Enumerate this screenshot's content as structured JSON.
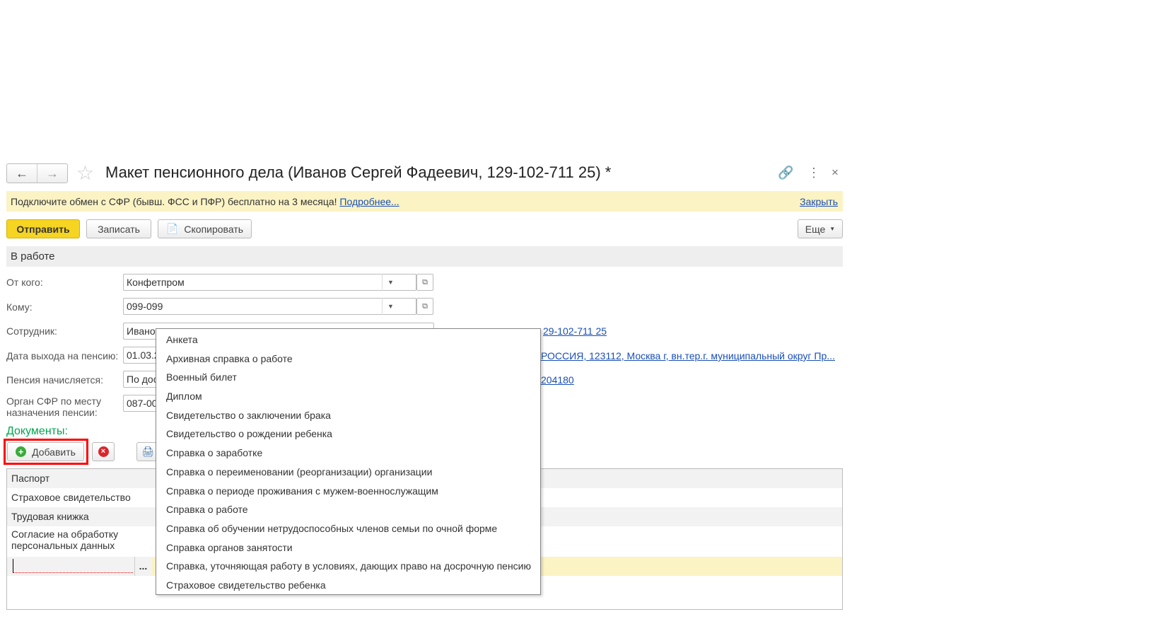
{
  "window": {
    "title": "Макет пенсионного дела (Иванов Сергей Фадеевич, 129-102-711 25) *"
  },
  "banner": {
    "text": "Подключите обмен с СФР (бывш. ФСС и ПФР) бесплатно на 3 месяца!",
    "more_link": "Подробнее...",
    "close_link": "Закрыть"
  },
  "toolbar": {
    "send": "Отправить",
    "save": "Записать",
    "copy": "Скопировать",
    "more": "Еще"
  },
  "status": "В работе",
  "form": {
    "from": {
      "label": "От кого:",
      "value": "Конфетпром"
    },
    "to": {
      "label": "Кому:",
      "value": "099-099"
    },
    "employee": {
      "label": "Сотрудник:",
      "value": "Ивано",
      "link": "29-102-711 25"
    },
    "retire_date": {
      "label": "Дата выхода на пенсию:",
      "value": "01.03.2",
      "link": "РОССИЯ, 123112, Москва г, вн.тер.г. муниципальный округ Пр..."
    },
    "pension": {
      "label": "Пенсия начисляется:",
      "value": "По дос",
      "link": "204180"
    },
    "sfr": {
      "label1": "Орган СФР по месту",
      "label2": "назначения пенсии:",
      "value": "087-00"
    }
  },
  "documents": {
    "label": "Документы:",
    "add": "Добавить",
    "rows": [
      "Паспорт",
      "Страховое свидетельство",
      "Трудовая книжка",
      "Согласие на обработку персональных данных"
    ],
    "edit_ellipsis": "..."
  },
  "dropdown": [
    "Анкета",
    "Архивная справка о работе",
    "Военный билет",
    "Диплом",
    "Свидетельство о заключении брака",
    "Свидетельство о рождении ребенка",
    "Справка о заработке",
    "Справка о переименовании (реорганизации) организации",
    "Справка о периоде проживания с мужем-военнослужащим",
    "Справка о работе",
    "Справка об обучении нетрудоспособных членов семьи по очной форме",
    "Справка органов занятости",
    "Справка, уточняющая работу в условиях, дающих право на досрочную пенсию",
    "Страховое свидетельство ребенка"
  ],
  "colors": {
    "send_button": "#f5d422",
    "banner": "#fbf3c4",
    "documents_label": "#00a650",
    "highlight": "#ff0000",
    "link": "#1a4fb8"
  }
}
